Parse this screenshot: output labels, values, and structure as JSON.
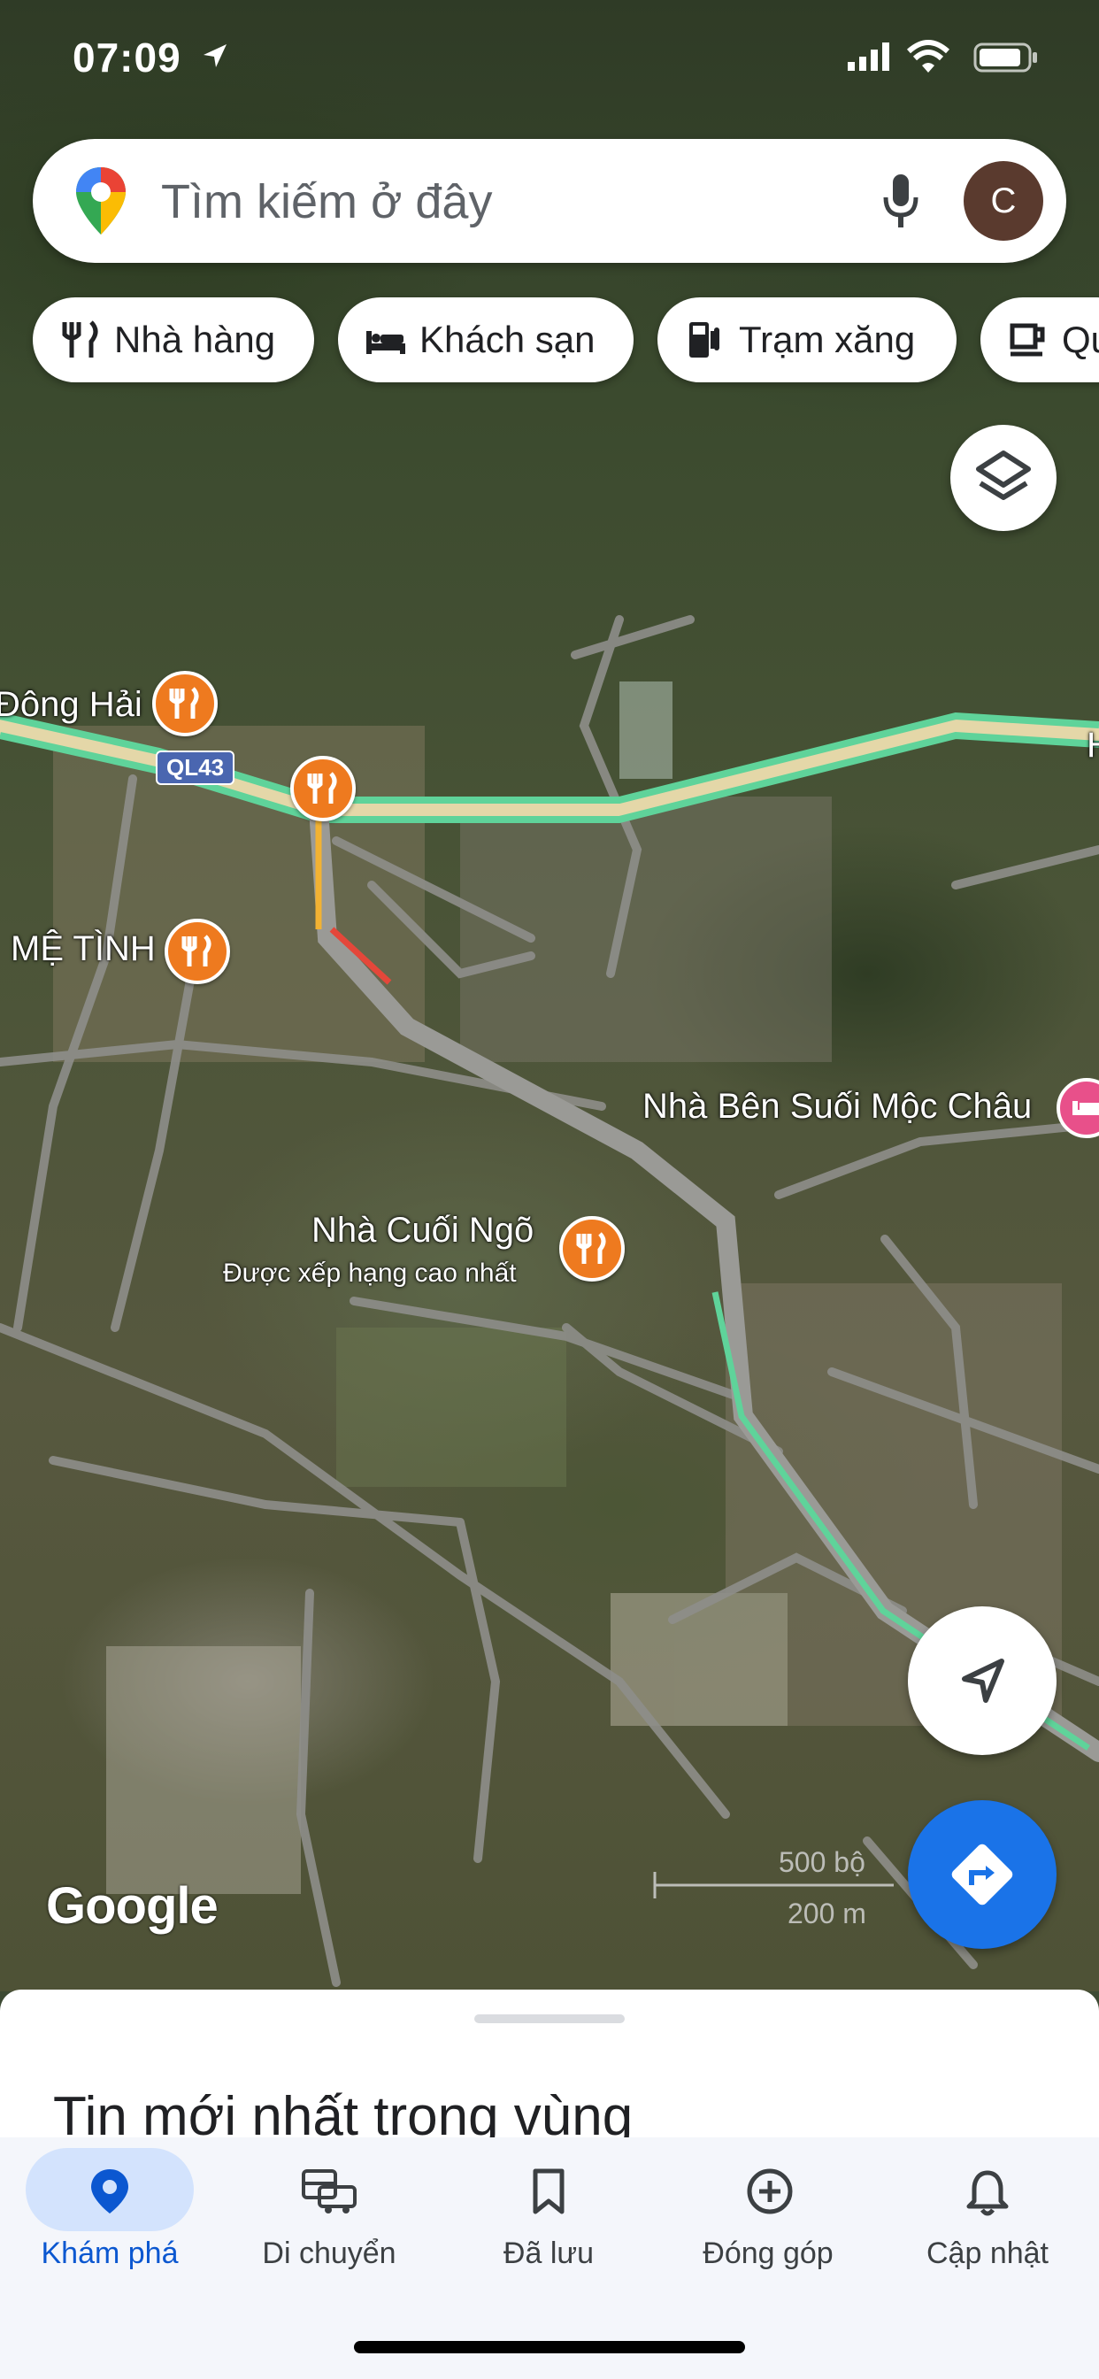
{
  "status_bar": {
    "time": "07:09"
  },
  "search": {
    "placeholder": "Tìm kiếm ở đây",
    "avatar_letter": "C"
  },
  "chips": [
    {
      "label": "Nhà hàng",
      "icon": "fork-knife-icon"
    },
    {
      "label": "Khách sạn",
      "icon": "bed-icon"
    },
    {
      "label": "Trạm xăng",
      "icon": "gas-pump-icon"
    },
    {
      "label": "Qu",
      "icon": "coffee-cup-icon"
    }
  ],
  "map": {
    "road_label": "QL43",
    "pois": [
      {
        "name": "Đông Hải",
        "type": "restaurant"
      },
      {
        "name": "MỆ TÌNH",
        "type": "restaurant"
      },
      {
        "name": "Nhà Bên Suối Mộc Châu",
        "type": "hotel"
      },
      {
        "name": "Nhà Cuối Ngõ",
        "subtitle": "Được xếp hạng cao nhất",
        "type": "restaurant"
      }
    ],
    "edge_label": "H",
    "scale": {
      "ft": "500 bộ",
      "m": "200 m"
    },
    "attribution": "Google"
  },
  "sheet": {
    "title": "Tin mới nhất trong vùng"
  },
  "bottom_nav": [
    {
      "label": "Khám phá",
      "icon": "location-pin-icon",
      "active": true
    },
    {
      "label": "Di chuyển",
      "icon": "car-transit-icon",
      "active": false
    },
    {
      "label": "Đã lưu",
      "icon": "bookmark-icon",
      "active": false
    },
    {
      "label": "Đóng góp",
      "icon": "add-circle-icon",
      "active": false
    },
    {
      "label": "Cập nhật",
      "icon": "bell-icon",
      "active": false
    }
  ],
  "colors": {
    "accent": "#1a73e8",
    "poi_restaurant": "#ee7a1f",
    "poi_hotel": "#e8508a",
    "traffic_green": "#5fd39a"
  }
}
